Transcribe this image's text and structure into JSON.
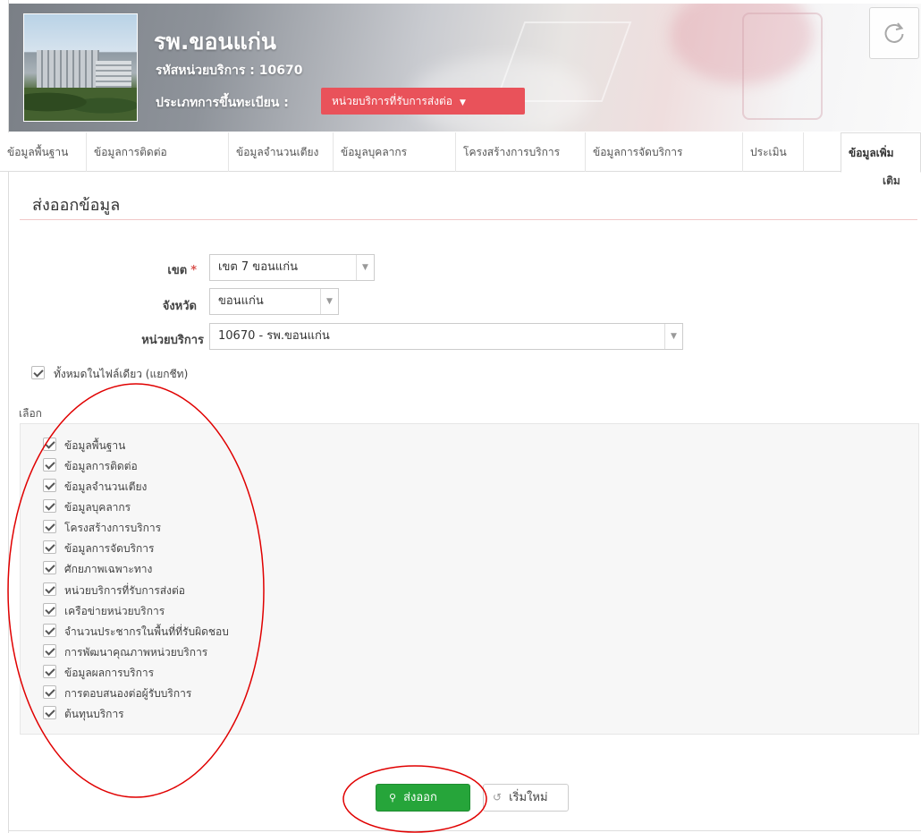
{
  "header": {
    "hospital_name": "รพ.ขอนแก่น",
    "service_code": "รหัสหน่วยบริการ : 10670",
    "registration_label": "ประเภทการขึ้นทะเบียน :",
    "registration_value": "หน่วยบริการที่รับการส่งต่อ",
    "registration_color": "#e9525a",
    "refresh_icon": "refresh-icon"
  },
  "tabs": [
    {
      "label": "ข้อมูลพื้นฐาน"
    },
    {
      "label": "ข้อมูลการติดต่อ"
    },
    {
      "label": "ข้อมูลจำนวนเตียง"
    },
    {
      "label": "ข้อมูลบุคลากร"
    },
    {
      "label": "โครงสร้างการบริการ"
    },
    {
      "label": "ข้อมูลการจัดบริการ"
    },
    {
      "label": "ประเมิน"
    },
    {
      "label": "ข้อมูลเพิ่ม",
      "label_line2": "เติม",
      "active": true
    }
  ],
  "section": {
    "title": "ส่งออกข้อมูล"
  },
  "form": {
    "zone_label": "เขต",
    "zone_required": "*",
    "zone_value": "เขต 7 ขอนแก่น",
    "province_label": "จังหวัด",
    "province_value": "ขอนแก่น",
    "unit_label": "หน่วยบริการ",
    "unit_value": "10670 - รพ.ขอนแก่น",
    "single_file_label": "ทั้งหมดในไฟล์เดียว (แยกชีท)",
    "single_file_checked": true
  },
  "choose_label": "เลือก",
  "items": [
    {
      "label": "ข้อมูลพื้นฐาน",
      "checked": true
    },
    {
      "label": "ข้อมูลการติดต่อ",
      "checked": true
    },
    {
      "label": "ข้อมูลจำนวนเตียง",
      "checked": true
    },
    {
      "label": "ข้อมูลบุคลากร",
      "checked": true
    },
    {
      "label": "โครงสร้างการบริการ",
      "checked": true
    },
    {
      "label": "ข้อมูลการจัดบริการ",
      "checked": true
    },
    {
      "label": "ศักยภาพเฉพาะทาง",
      "checked": true
    },
    {
      "label": "หน่วยบริการที่รับการส่งต่อ",
      "checked": true
    },
    {
      "label": "เครือข่ายหน่วยบริการ",
      "checked": true
    },
    {
      "label": "จำนวนประชากรในพื้นที่ที่รับผิดชอบ",
      "checked": true
    },
    {
      "label": "การพัฒนาคุณภาพหน่วยบริการ",
      "checked": true
    },
    {
      "label": "ข้อมูลผลการบริการ",
      "checked": true
    },
    {
      "label": "การตอบสนองต่อผู้รับบริการ",
      "checked": true
    },
    {
      "label": "ต้นทุนบริการ",
      "checked": true
    }
  ],
  "buttons": {
    "export_label": "ส่งออก",
    "export_color": "#26a53a",
    "reset_label": "เริ่มใหม่"
  },
  "annotation_color": "#e00000"
}
